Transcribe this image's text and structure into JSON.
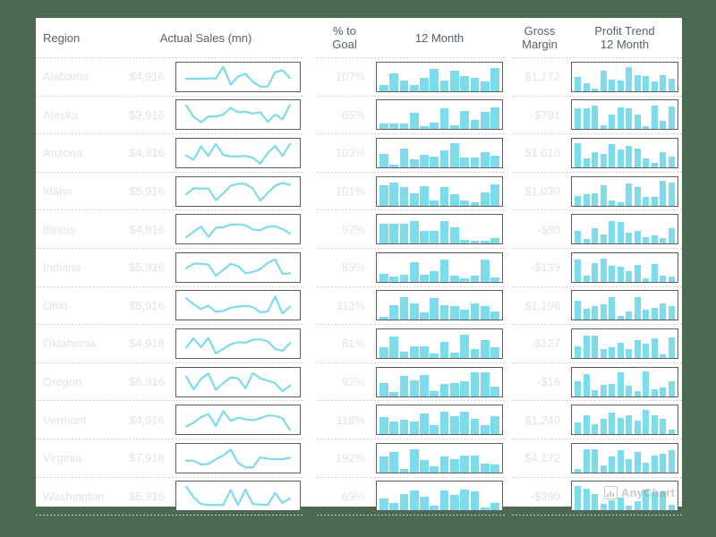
{
  "background_color": "#4c6a51",
  "card_color": "#ffffff",
  "accent_color": "#7ddceb",
  "muted_text_color": "#e2e4e4",
  "header_text_color": "#586369",
  "frame_border_color": "#575f63",
  "watermark": {
    "label": "AnyChart",
    "icon": "barchart-icon"
  },
  "table": {
    "headers": {
      "region": "Region",
      "actual_sales": "Actual Sales (mn)",
      "pct_to_goal": "% to\nGoal",
      "pct_to_goal_line1": "% to",
      "pct_to_goal_line2": "Goal",
      "twelve_month": "12 Month",
      "gross_margin_line1": "Gross",
      "gross_margin_line2": "Margin",
      "profit_trend_line1": "Profit Trend",
      "profit_trend_line2": "12 Month"
    },
    "rows": [
      {
        "region": "Alabama",
        "actual_sales": "$4,916",
        "pct_to_goal": "107%",
        "gross_margin": "$1,172",
        "sales_spark": [
          42,
          43,
          43,
          44,
          44,
          92,
          18,
          52,
          63,
          30,
          10,
          10,
          70,
          78,
          45
        ],
        "twelve_month_bars": [
          22,
          70,
          40,
          24,
          52,
          84,
          42,
          80,
          58,
          52,
          38,
          90
        ],
        "profit_trend_bars": [
          55,
          30,
          10,
          78,
          45,
          42,
          92,
          60,
          58,
          38,
          62,
          48
        ]
      },
      {
        "region": "Alaska",
        "actual_sales": "$3,916",
        "pct_to_goal": "65%",
        "gross_margin": "-$791",
        "sales_spark": [
          88,
          40,
          18,
          42,
          42,
          50,
          78,
          60,
          62,
          54,
          60,
          20,
          50,
          30,
          90
        ],
        "twelve_month_bars": [
          22,
          22,
          22,
          62,
          12,
          24,
          80,
          14,
          72,
          36,
          66,
          84
        ],
        "profit_trend_bars": [
          80,
          80,
          92,
          14,
          56,
          84,
          80,
          58,
          12,
          90,
          34,
          86
        ]
      },
      {
        "region": "Arizona",
        "actual_sales": "$4,916",
        "pct_to_goal": "103%",
        "gross_margin": "$1,010",
        "sales_spark": [
          40,
          22,
          78,
          38,
          88,
          42,
          36,
          36,
          38,
          30,
          6,
          50,
          80,
          38,
          88
        ],
        "twelve_month_bars": [
          52,
          12,
          72,
          30,
          48,
          40,
          64,
          92,
          38,
          38,
          58,
          46
        ],
        "profit_trend_bars": [
          92,
          36,
          58,
          50,
          88,
          70,
          82,
          74,
          34,
          18,
          58,
          40
        ]
      },
      {
        "region": "Idaho",
        "actual_sales": "$5,916",
        "pct_to_goal": "101%",
        "gross_margin": "$1,030",
        "sales_spark": [
          38,
          64,
          62,
          62,
          14,
          42,
          74,
          82,
          82,
          62,
          12,
          44,
          74,
          86,
          78
        ],
        "twelve_month_bars": [
          78,
          88,
          70,
          46,
          74,
          20,
          72,
          44,
          18,
          12,
          50,
          82
        ],
        "profit_trend_bars": [
          36,
          44,
          46,
          78,
          20,
          12,
          86,
          70,
          34,
          34,
          96,
          88
        ]
      },
      {
        "region": "Illinois",
        "actual_sales": "$4,916",
        "pct_to_goal": "92%",
        "gross_margin": "-$90",
        "sales_spark": [
          16,
          40,
          60,
          18,
          56,
          58,
          68,
          70,
          66,
          48,
          46,
          60,
          62,
          50,
          32
        ],
        "twelve_month_bars": [
          78,
          76,
          76,
          86,
          50,
          48,
          86,
          62,
          16,
          12,
          12,
          22
        ],
        "profit_trend_bars": [
          48,
          18,
          58,
          34,
          88,
          84,
          42,
          50,
          26,
          30,
          20,
          60
        ]
      },
      {
        "region": "Indiana",
        "actual_sales": "$5,916",
        "pct_to_goal": "89%",
        "gross_margin": "-$139",
        "sales_spark": [
          48,
          66,
          66,
          62,
          16,
          40,
          66,
          56,
          26,
          32,
          44,
          70,
          84,
          24,
          26
        ],
        "twelve_month_bars": [
          32,
          20,
          28,
          74,
          26,
          42,
          84,
          24,
          12,
          22,
          84,
          16
        ],
        "profit_trend_bars": [
          84,
          22,
          70,
          90,
          60,
          58,
          40,
          66,
          14,
          68,
          22,
          20
        ]
      },
      {
        "region": "Ohio",
        "actual_sales": "$5,916",
        "pct_to_goal": "113%",
        "gross_margin": "$1,196",
        "sales_spark": [
          78,
          54,
          34,
          48,
          22,
          26,
          40,
          44,
          48,
          42,
          20,
          24,
          86,
          16,
          44
        ],
        "twelve_month_bars": [
          10,
          58,
          86,
          62,
          30,
          84,
          58,
          54,
          38,
          62,
          52,
          32
        ],
        "profit_trend_bars": [
          74,
          44,
          54,
          60,
          86,
          16,
          34,
          88,
          40,
          46,
          64,
          52
        ]
      },
      {
        "region": "Oklahoma",
        "actual_sales": "$4,916",
        "pct_to_goal": "81%",
        "gross_margin": "-$127",
        "sales_spark": [
          34,
          72,
          36,
          74,
          10,
          28,
          48,
          56,
          54,
          66,
          68,
          60,
          28,
          20,
          52
        ],
        "twelve_month_bars": [
          40,
          84,
          24,
          46,
          46,
          18,
          62,
          22,
          88,
          36,
          68,
          42
        ],
        "profit_trend_bars": [
          46,
          86,
          86,
          34,
          42,
          58,
          34,
          70,
          56,
          76,
          14,
          80
        ]
      },
      {
        "region": "Oregon",
        "actual_sales": "$6,916",
        "pct_to_goal": "92%",
        "gross_margin": "-$16",
        "sales_spark": [
          74,
          20,
          64,
          86,
          18,
          46,
          70,
          66,
          24,
          88,
          66,
          56,
          46,
          12,
          36
        ],
        "twelve_month_bars": [
          50,
          16,
          78,
          62,
          80,
          18,
          46,
          50,
          58,
          92,
          92,
          38
        ],
        "profit_trend_bars": [
          56,
          84,
          22,
          42,
          46,
          92,
          40,
          18,
          96,
          26,
          34,
          58
        ]
      },
      {
        "region": "Vermont",
        "actual_sales": "$4,916",
        "pct_to_goal": "118%",
        "gross_margin": "$1,240",
        "sales_spark": [
          22,
          38,
          60,
          74,
          24,
          86,
          46,
          58,
          52,
          48,
          56,
          68,
          66,
          56,
          8
        ],
        "twelve_month_bars": [
          66,
          48,
          56,
          48,
          80,
          36,
          88,
          70,
          86,
          60,
          34,
          70
        ],
        "profit_trend_bars": [
          46,
          72,
          38,
          60,
          84,
          62,
          74,
          52,
          92,
          72,
          58,
          18
        ]
      },
      {
        "region": "Virginia",
        "actual_sales": "$7,916",
        "pct_to_goal": "192%",
        "gross_margin": "$4,172",
        "sales_spark": [
          40,
          40,
          24,
          26,
          46,
          62,
          86,
          30,
          12,
          12,
          54,
          48,
          46,
          46,
          52
        ],
        "twelve_month_bars": [
          60,
          78,
          12,
          88,
          46,
          22,
          62,
          52,
          66,
          64,
          34,
          30
        ],
        "profit_trend_bars": [
          14,
          88,
          88,
          28,
          62,
          86,
          50,
          80,
          36,
          66,
          70,
          84
        ]
      },
      {
        "region": "Washington",
        "actual_sales": "$5,916",
        "pct_to_goal": "69%",
        "gross_margin": "-$390",
        "sales_spark": [
          88,
          44,
          16,
          12,
          12,
          12,
          74,
          12,
          76,
          16,
          14,
          12,
          62,
          20,
          40
        ],
        "twelve_month_bars": [
          46,
          30,
          62,
          78,
          52,
          20,
          78,
          60,
          82,
          74,
          10,
          28
        ],
        "profit_trend_bars": [
          94,
          84,
          62,
          24,
          38,
          48,
          20,
          34,
          82,
          70,
          74,
          22
        ]
      }
    ]
  }
}
